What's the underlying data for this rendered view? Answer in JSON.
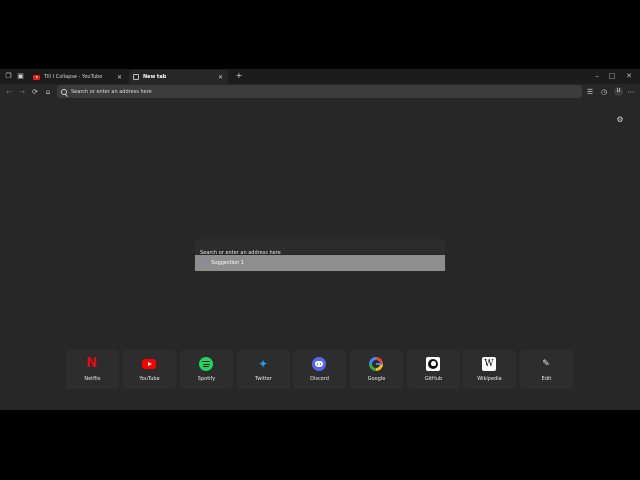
{
  "tabs": [
    {
      "title": "Till I Collapse - YouTube",
      "favicon": "youtube-icon",
      "active": false
    },
    {
      "title": "New tab",
      "favicon": "new-tab-page-icon",
      "active": true
    }
  ],
  "toolbar": {
    "address_placeholder": "Search or enter an address here",
    "profile_initial": "U"
  },
  "search": {
    "placeholder": "Search or enter an address here",
    "suggestions": [
      "Suggestion 1"
    ]
  },
  "quick_links": [
    {
      "label": "Netflix",
      "icon": "netflix-icon"
    },
    {
      "label": "YouTube",
      "icon": "youtube-icon"
    },
    {
      "label": "Spotify",
      "icon": "spotify-icon"
    },
    {
      "label": "Twitter",
      "icon": "twitter-icon"
    },
    {
      "label": "Discord",
      "icon": "discord-icon"
    },
    {
      "label": "Google",
      "icon": "google-icon"
    },
    {
      "label": "GitHub",
      "icon": "github-icon"
    },
    {
      "label": "Wikipedia",
      "icon": "wikipedia-icon"
    },
    {
      "label": "Edit",
      "icon": "pencil-icon"
    }
  ],
  "colors": {
    "background": "#272727",
    "tabbar": "#1c1c1c",
    "addressbar": "#3b3b3b",
    "suggestion_highlight": "#8e8e8e",
    "tile": "#2d2d2d"
  }
}
